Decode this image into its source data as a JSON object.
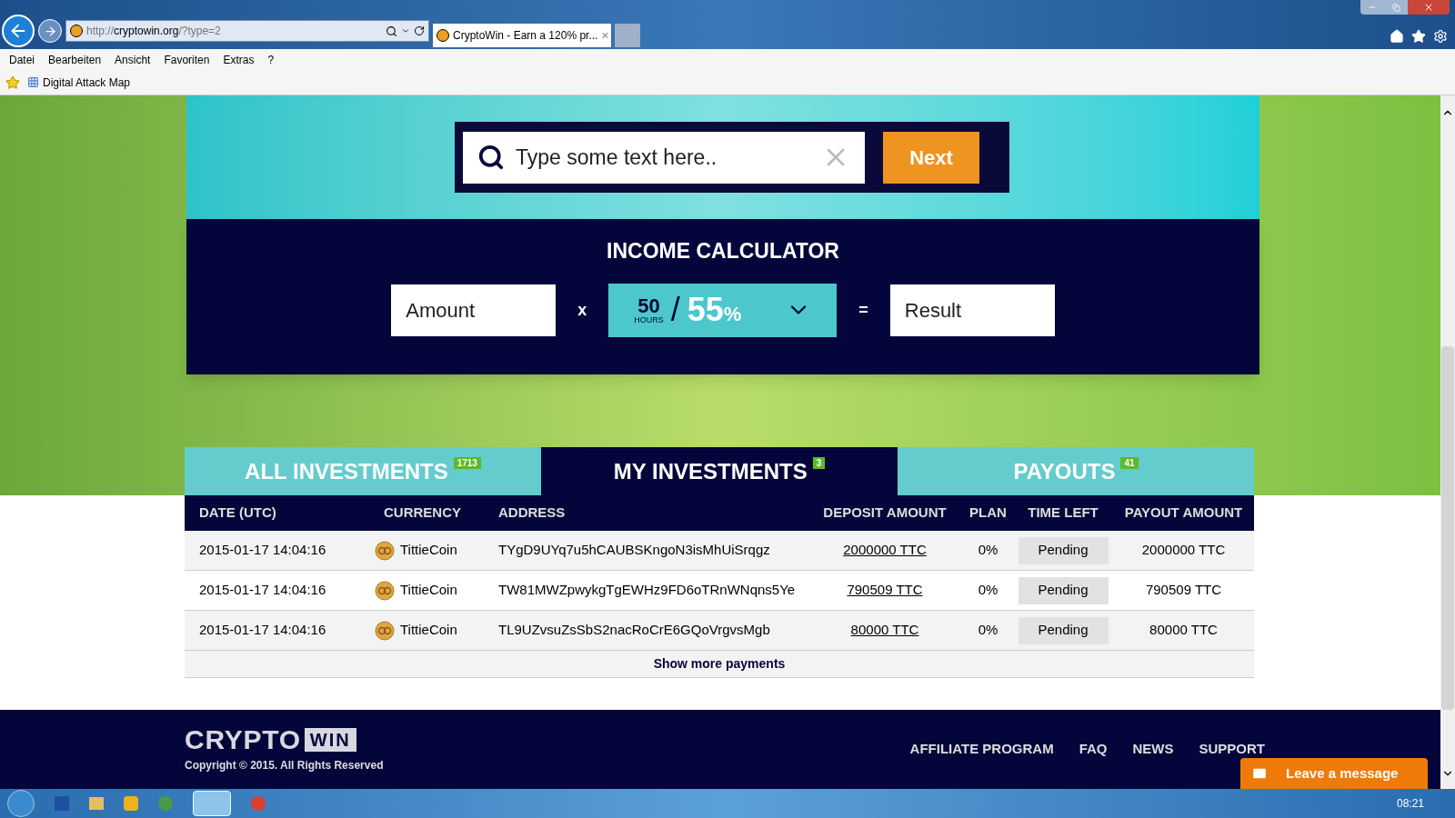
{
  "browser": {
    "address_prefix": "http://",
    "address_host": "cryptowin.org",
    "address_path": "/?type=2",
    "tab_title": "CryptoWin - Earn a 120% pr...",
    "tab_close": "×",
    "menu": [
      "Datei",
      "Bearbeiten",
      "Ansicht",
      "Favoriten",
      "Extras",
      "?"
    ],
    "favorites": [
      "Digital Attack Map"
    ]
  },
  "search": {
    "placeholder": "Type some text here..",
    "button": "Next"
  },
  "calculator": {
    "title": "INCOME CALCULATOR",
    "amount_placeholder": "Amount",
    "times": "x",
    "hours": "50",
    "hours_label": "HOURS",
    "slash": "/",
    "percent": "55",
    "percent_sign": "%",
    "equals": "=",
    "result_placeholder": "Result"
  },
  "tabs": [
    {
      "label": "ALL INVESTMENTS",
      "count": "1713",
      "selected": false
    },
    {
      "label": "MY INVESTMENTS",
      "count": "3",
      "selected": true
    },
    {
      "label": "PAYOUTS",
      "count": "41",
      "selected": false
    }
  ],
  "table": {
    "columns": [
      "DATE (UTC)",
      "CURRENCY",
      "ADDRESS",
      "DEPOSIT AMOUNT",
      "PLAN",
      "TIME LEFT",
      "PAYOUT AMOUNT"
    ],
    "rows": [
      {
        "date": "2015-01-17 14:04:16",
        "currency": "TittieCoin",
        "address": "TYgD9UYq7u5hCAUBSKngoN3isMhUiSrqgz",
        "deposit": "2000000 TTC",
        "plan": "0%",
        "time_left": "Pending",
        "payout": "2000000 TTC"
      },
      {
        "date": "2015-01-17 14:04:16",
        "currency": "TittieCoin",
        "address": "TW81MWZpwykgTgEWHz9FD6oTRnWNqns5Ye",
        "deposit": "790509 TTC",
        "plan": "0%",
        "time_left": "Pending",
        "payout": "790509 TTC"
      },
      {
        "date": "2015-01-17 14:04:16",
        "currency": "TittieCoin",
        "address": "TL9UZvsuZsSbS2nacRoCrE6GQoVrgvsMgb",
        "deposit": "80000 TTC",
        "plan": "0%",
        "time_left": "Pending",
        "payout": "80000 TTC"
      }
    ],
    "show_more": "Show more payments"
  },
  "footer": {
    "logo_main": "CRYPTO",
    "logo_box": "WIN",
    "copyright": "Copyright © 2015. All Rights Reserved",
    "links": [
      "AFFILIATE PROGRAM",
      "FAQ",
      "NEWS",
      "SUPPORT"
    ]
  },
  "chat": {
    "label": "Leave a message"
  },
  "taskbar": {
    "time": "08:21"
  }
}
